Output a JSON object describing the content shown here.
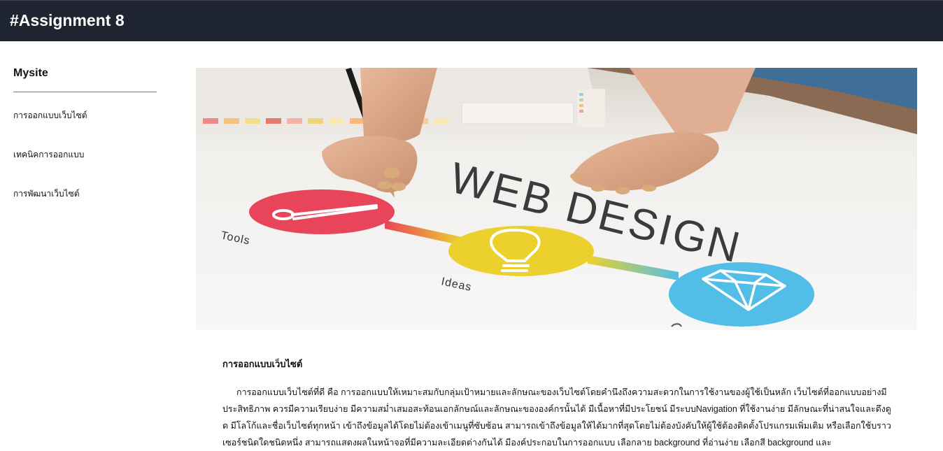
{
  "header": {
    "title": "#Assignment 8"
  },
  "sidebar": {
    "brand": "Mysite",
    "items": [
      {
        "label": "การออกแบบเว็บไซต์"
      },
      {
        "label": "เทคนิคการออกแบบ"
      },
      {
        "label": "การพัฒนาเว็บไซต์"
      }
    ]
  },
  "hero": {
    "headline": "WEB DESIGN",
    "labels": {
      "tools": "Tools",
      "ideas": "Ideas"
    },
    "icons": [
      "brush-icon",
      "lightbulb-icon",
      "diamond-icon"
    ],
    "colors": {
      "tools": "#e8455a",
      "ideas": "#ecd12e",
      "diamond": "#52bde6"
    }
  },
  "article": {
    "title": "การออกแบบเว็บไซต์",
    "body": "การออกแบบเว็บไซต์ที่ดี คือ การออกแบบให้เหมาะสมกับกลุ่มเป้าหมายและลักษณะของเว็บไซต์โดยคำนึงถึงความสะดวกในการใช้งานของผู้ใช้เป็นหลัก เว็บไซต์ที่ออกแบบอย่างมีประสิทธิภาพ ควรมีความเรียบง่าย มีความสม่ำเสมอสะท้อนเอกลักษณ์และลักษณะขององค์กรนั้นได้ มีเนื้อหาที่มีประโยชน์ มีระบบNavigation ที่ใช้งานง่าย มีลักษณะที่น่าสนใจและดึงดูด มีโลโก้และชื่อเว็บไซต์ทุกหน้า เข้าถึงข้อมูลได้โดยไม่ต้องเข้าเมนูที่ซับซ้อน สามารถเข้าถึงข้อมูลให้ได้มากที่สุดโดยไม่ต้องบังคับให้ผู้ใช้ต้องติดตั้งโปรแกรมเพิ่มเติม หรือเลือกใช้บราวเซอร์ชนิดใดชนิดหนึ่ง สามารถแสดงผลในหน้าจอที่มีความละเอียดต่างกันได้ มีองค์ประกอบในการออกแบบ เลือกลาย background ที่อ่านง่าย เลือกสี background และ"
  }
}
